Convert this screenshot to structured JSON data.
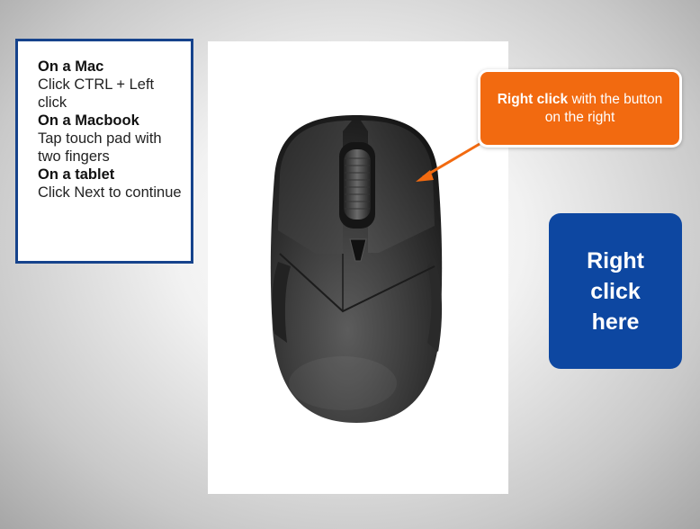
{
  "instructions": {
    "mac_heading": "On a Mac",
    "mac_text": "Click CTRL + Left click",
    "macbook_heading": "On a Macbook",
    "macbook_text": "Tap touch pad with two fingers",
    "tablet_heading": "On a tablet",
    "tablet_text": "Click Next to continue"
  },
  "callout": {
    "bold": "Right click",
    "rest": "with the button on the right"
  },
  "hotspot": {
    "label": "Right click here"
  },
  "colors": {
    "border_blue": "#16438c",
    "hotspot_blue": "#0d47a1",
    "callout_orange": "#f26a10"
  },
  "image": {
    "subject": "computer-mouse-icon"
  }
}
